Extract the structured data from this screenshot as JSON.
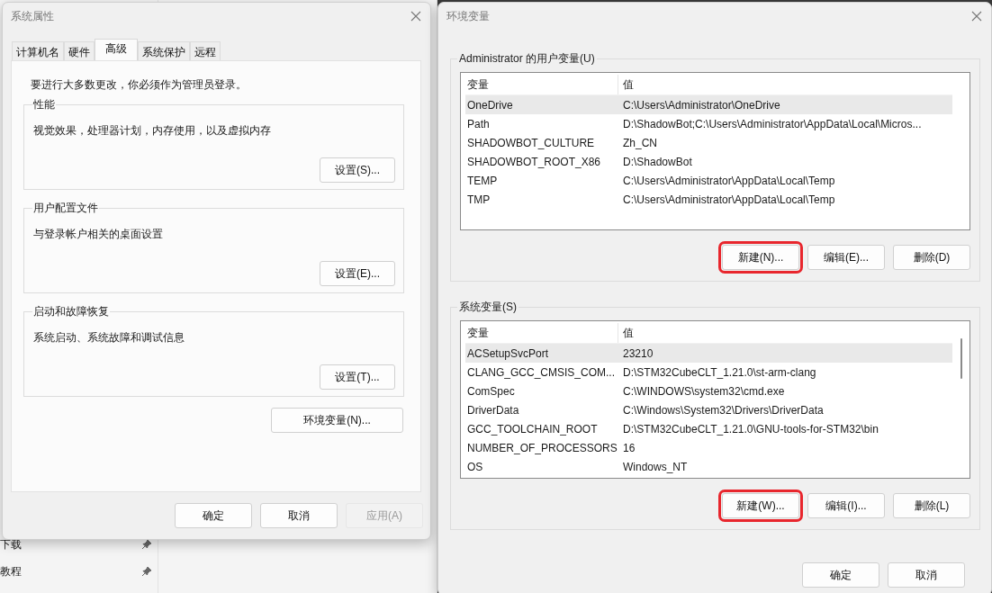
{
  "background_sidebar": {
    "items": [
      {
        "label": "下载",
        "pinned": true
      },
      {
        "label": "教程",
        "pinned": true
      }
    ]
  },
  "system_properties": {
    "title": "系统属性",
    "tabs": [
      {
        "label": "计算机名",
        "selected": false
      },
      {
        "label": "硬件",
        "selected": false
      },
      {
        "label": "高级",
        "selected": true
      },
      {
        "label": "系统保护",
        "selected": false
      },
      {
        "label": "远程",
        "selected": false
      }
    ],
    "notice": "要进行大多数更改，你必须作为管理员登录。",
    "groups": [
      {
        "legend": "性能",
        "description": "视觉效果，处理器计划，内存使用，以及虚拟内存",
        "button": "设置(S)..."
      },
      {
        "legend": "用户配置文件",
        "description": "与登录帐户相关的桌面设置",
        "button": "设置(E)..."
      },
      {
        "legend": "启动和故障恢复",
        "description": "系统启动、系统故障和调试信息",
        "button": "设置(T)..."
      }
    ],
    "env_button": "环境变量(N)...",
    "buttons": [
      {
        "label": "确定",
        "disabled": false
      },
      {
        "label": "取消",
        "disabled": false
      },
      {
        "label": "应用(A)",
        "disabled": true
      }
    ]
  },
  "environment_variables": {
    "title": "环境变量",
    "user_variables": {
      "legend": "Administrator 的用户变量(U)",
      "columns": [
        "变量",
        "值"
      ],
      "rows": [
        {
          "name": "OneDrive",
          "value": "C:\\Users\\Administrator\\OneDrive",
          "selected": true
        },
        {
          "name": "Path",
          "value": "D:\\ShadowBot;C:\\Users\\Administrator\\AppData\\Local\\Micros...",
          "selected": false
        },
        {
          "name": "SHADOWBOT_CULTURE",
          "value": "Zh_CN",
          "selected": false
        },
        {
          "name": "SHADOWBOT_ROOT_X86",
          "value": "D:\\ShadowBot",
          "selected": false
        },
        {
          "name": "TEMP",
          "value": "C:\\Users\\Administrator\\AppData\\Local\\Temp",
          "selected": false
        },
        {
          "name": "TMP",
          "value": "C:\\Users\\Administrator\\AppData\\Local\\Temp",
          "selected": false
        }
      ],
      "buttons": [
        {
          "label": "新建(N)...",
          "highlighted": true
        },
        {
          "label": "编辑(E)...",
          "highlighted": false
        },
        {
          "label": "删除(D)",
          "highlighted": false
        }
      ]
    },
    "system_variables": {
      "legend": "系统变量(S)",
      "columns": [
        "变量",
        "值"
      ],
      "rows": [
        {
          "name": "ACSetupSvcPort",
          "value": "23210",
          "selected": true
        },
        {
          "name": "CLANG_GCC_CMSIS_COM...",
          "value": "D:\\STM32CubeCLT_1.21.0\\st-arm-clang",
          "selected": false
        },
        {
          "name": "ComSpec",
          "value": "C:\\WINDOWS\\system32\\cmd.exe",
          "selected": false
        },
        {
          "name": "DriverData",
          "value": "C:\\Windows\\System32\\Drivers\\DriverData",
          "selected": false
        },
        {
          "name": "GCC_TOOLCHAIN_ROOT",
          "value": "D:\\STM32CubeCLT_1.21.0\\GNU-tools-for-STM32\\bin",
          "selected": false
        },
        {
          "name": "NUMBER_OF_PROCESSORS",
          "value": "16",
          "selected": false
        },
        {
          "name": "OS",
          "value": "Windows_NT",
          "selected": false
        }
      ],
      "buttons": [
        {
          "label": "新建(W)...",
          "highlighted": true
        },
        {
          "label": "编辑(I)...",
          "highlighted": false
        },
        {
          "label": "删除(L)",
          "highlighted": false
        }
      ]
    },
    "buttons": [
      "确定",
      "取消"
    ]
  }
}
